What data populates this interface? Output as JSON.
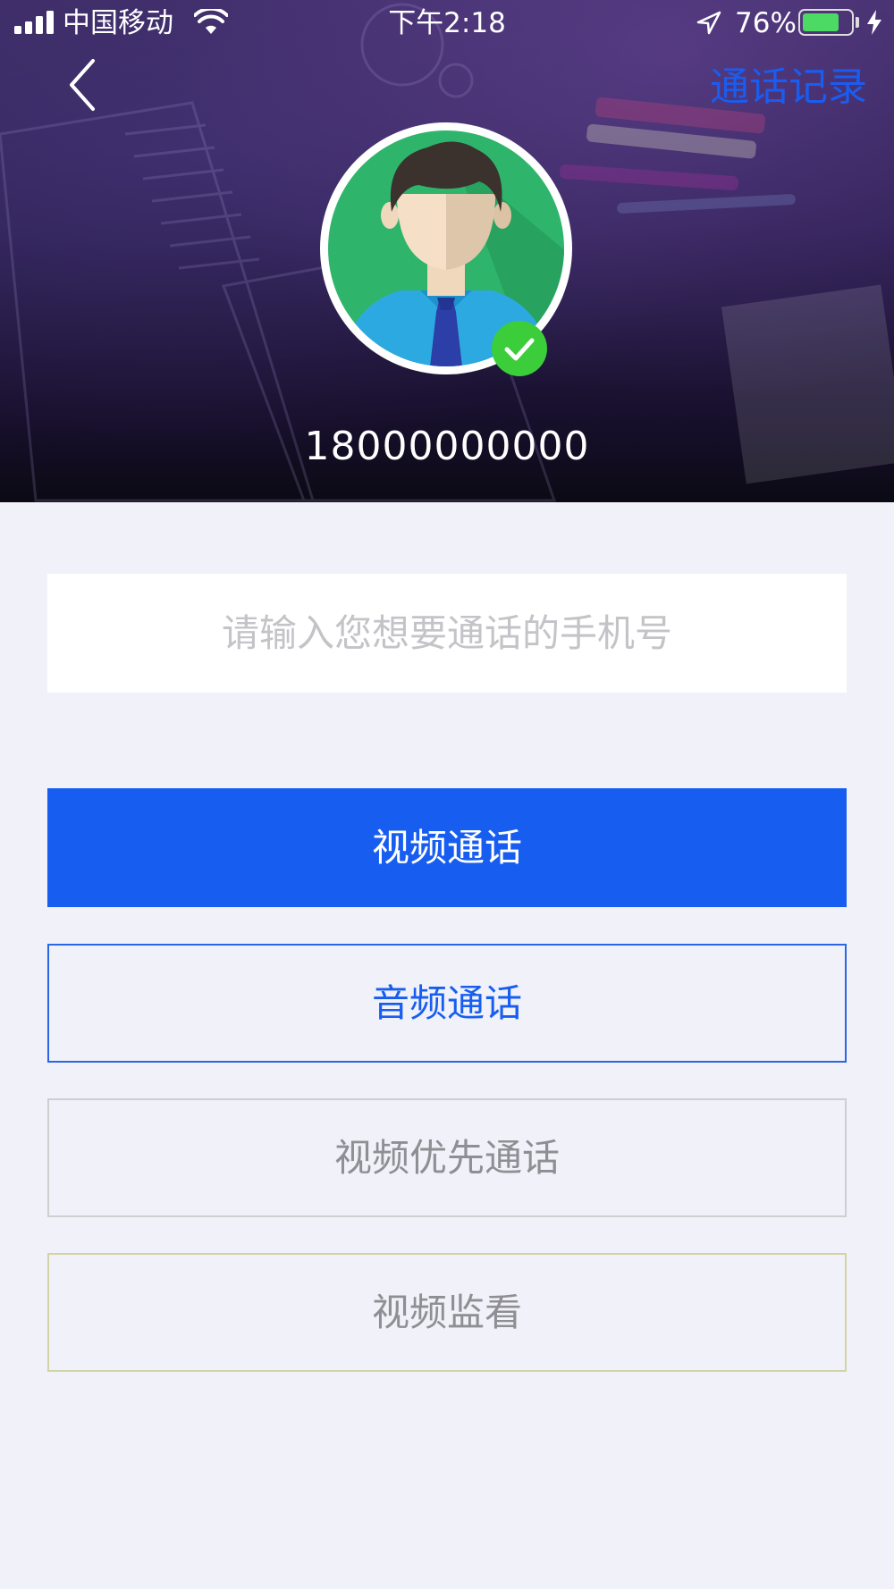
{
  "status_bar": {
    "carrier": "中国移动",
    "time": "下午2:18",
    "battery": "76%",
    "battery_level": 0.76
  },
  "nav": {
    "history_label": "通话记录"
  },
  "profile": {
    "phone_number": "18000000000"
  },
  "form": {
    "phone_placeholder": "请输入您想要通话的手机号",
    "phone_value": ""
  },
  "actions": {
    "video_call": "视频通话",
    "audio_call": "音频通话",
    "video_first_call": "视频优先通话",
    "video_monitor": "视频监看"
  },
  "colors": {
    "accent": "#175ef0",
    "page_background": "#f0f1f9",
    "verified_badge": "#3ccd3a"
  }
}
